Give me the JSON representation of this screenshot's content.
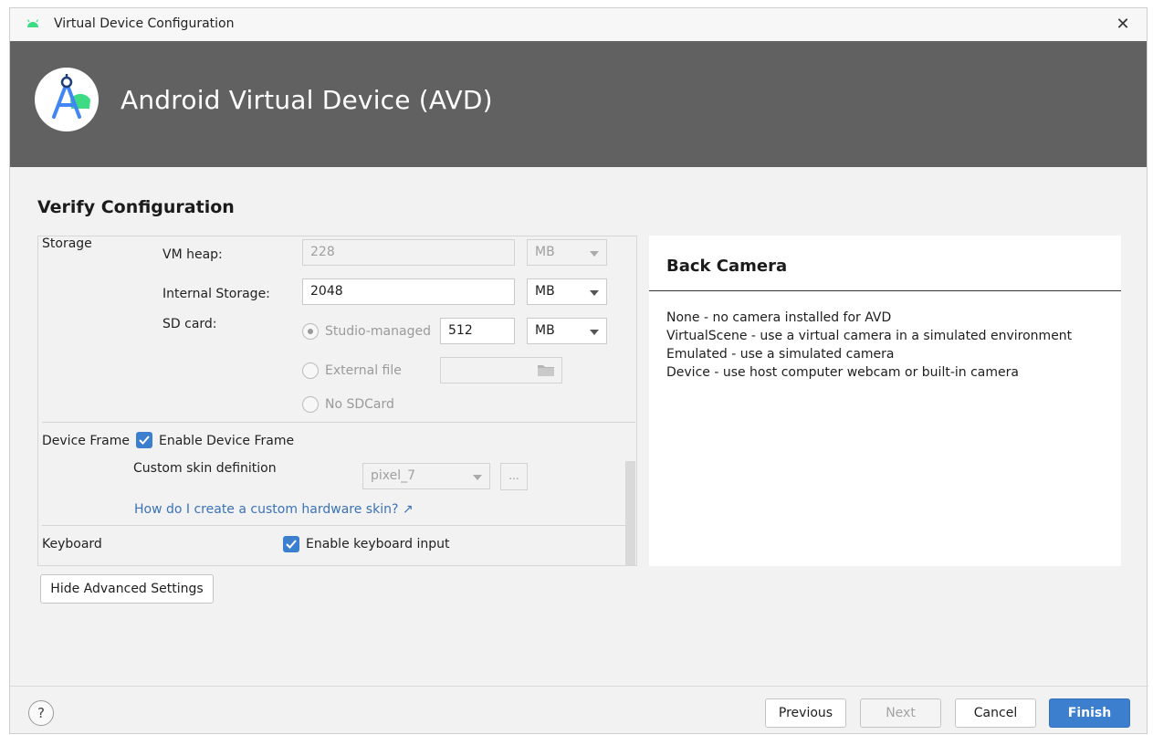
{
  "window": {
    "title": "Virtual Device Configuration",
    "close_glyph": "✕"
  },
  "banner": {
    "title": "Android Virtual Device (AVD)"
  },
  "page": {
    "section_title": "Verify Configuration"
  },
  "storage": {
    "group_label": "Storage",
    "vm_heap_label": "VM heap:",
    "vm_heap_value": "228",
    "vm_heap_unit": "MB",
    "internal_storage_label": "Internal Storage:",
    "internal_storage_value": "2048",
    "internal_storage_unit": "MB",
    "sd_card_label": "SD card:",
    "studio_managed_label": "Studio-managed",
    "sd_size_value": "512",
    "sd_size_unit": "MB",
    "external_file_label": "External file",
    "external_file_value": "",
    "no_sdcard_label": "No SDCard",
    "selected_option": "Studio-managed"
  },
  "device_frame": {
    "group_label": "Device Frame",
    "enable_label": "Enable Device Frame",
    "enabled": true,
    "custom_skin_label": "Custom skin definition",
    "custom_skin_value": "pixel_7",
    "browse_label": "...",
    "help_link": "How do I create a custom hardware skin? ↗"
  },
  "keyboard": {
    "group_label": "Keyboard",
    "enable_label": "Enable keyboard input",
    "enabled": true
  },
  "advanced": {
    "hide_button": "Hide Advanced Settings"
  },
  "info_panel": {
    "title": "Back Camera",
    "lines": [
      "None - no camera installed for AVD",
      "VirtualScene - use a virtual camera in a simulated environment",
      "Emulated - use a simulated camera",
      "Device - use host computer webcam or built-in camera"
    ]
  },
  "footer": {
    "help_glyph": "?",
    "previous": "Previous",
    "next": "Next",
    "cancel": "Cancel",
    "finish": "Finish"
  },
  "colors": {
    "banner_bg": "#616161",
    "accent_blue": "#3d7fcf",
    "android_green": "#3ddc84",
    "link_blue": "#3a72b8"
  },
  "icons": {
    "title": "android-head-icon",
    "logo": "android-studio-logo-icon",
    "folder": "folder-icon",
    "external_link": "external-link-icon"
  }
}
